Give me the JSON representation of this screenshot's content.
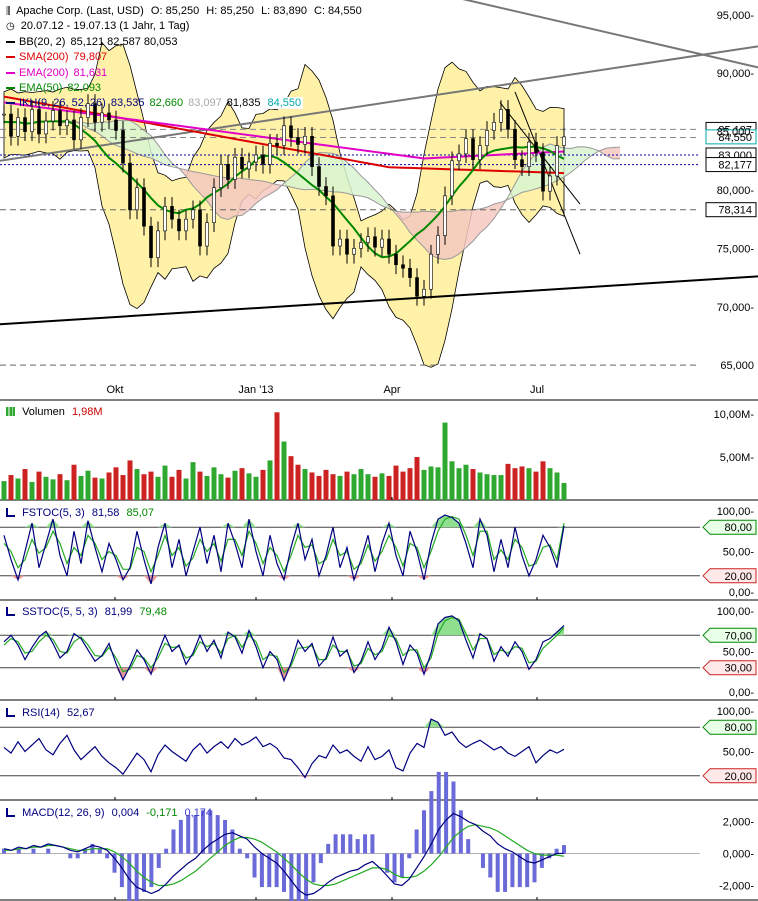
{
  "chart_data": [
    {
      "type": "line",
      "title": "Apache Corp. (Last, USD)",
      "ohlc_labels": {
        "o": "O: 85,250",
        "h": "H: 85,250",
        "l": "L: 83,890",
        "c": "C: 84,550"
      },
      "date_range": "20.07.12 - 19.07.13 (1 Jahr, 1 Tag)",
      "x_ticks": [
        "Okt",
        "Jan '13",
        "Apr",
        "Jul"
      ],
      "ylim": [
        63500,
        97000
      ],
      "y_ticks": [
        "95,000-",
        "90,000-",
        "85,000-",
        "80,000-",
        "75,000-",
        "70,000-",
        "65,000"
      ],
      "price_tags": [
        "85,187",
        "84,550",
        "83,000",
        "82,177",
        "78,314"
      ],
      "indicators": [
        {
          "name": "BB(20, 2)",
          "values": "85,121  82,587  80,053",
          "color": "#000000"
        },
        {
          "name": "SMA(200)",
          "values": "79,807",
          "color": "#dd0000"
        },
        {
          "name": "EMA(200)",
          "values": "81,631",
          "color": "#e000c8"
        },
        {
          "name": "EMA(50)",
          "values": "82,093",
          "color": "#008800"
        },
        {
          "name": "IKH(9, 26, 52, 26)",
          "values": [
            "83,535",
            "82,660",
            "83,097",
            "81,835",
            "84,550"
          ],
          "value_colors": [
            "#000080",
            "#008800",
            "#aaaaaa",
            "#000000",
            "#00aaaa"
          ],
          "color": "#000080"
        }
      ],
      "series": [
        {
          "name": "Close",
          "values": [
            86.5,
            84.6,
            86.2,
            85.0,
            86.9,
            84.8,
            85.9,
            86.8,
            85.5,
            86.0,
            84.3,
            86.2,
            87.4,
            85.8,
            86.6,
            86.0,
            85.1,
            82.3,
            78.3,
            80.2,
            76.9,
            74.2,
            76.5,
            78.6,
            77.5,
            76.5,
            77.5,
            78.3,
            75.2,
            77.2,
            80.2,
            82.2,
            80.9,
            82.8,
            81.8,
            82.4,
            83.0,
            82.2,
            84.0,
            83.8,
            85.5,
            84.5,
            83.9,
            84.6,
            82.0,
            80.3,
            79.5,
            75.2,
            75.8,
            74.5,
            75.0,
            75.5,
            76.0,
            75.1,
            75.8,
            74.5,
            73.6,
            73.3,
            72.5,
            70.9,
            71.5,
            74.5,
            76.1,
            79.5,
            82.5,
            83.1,
            84.4,
            82.6,
            83.8,
            85.1,
            85.8,
            86.9,
            85.2,
            82.6,
            82.0,
            84.1,
            83.2,
            79.9,
            81.2,
            83.8,
            84.55
          ]
        }
      ]
    },
    {
      "type": "bar",
      "title": "Volumen",
      "value_label": "1,98M",
      "y_ticks": [
        "10,00M-",
        "5,00M-"
      ],
      "values": [
        2.2,
        2.9,
        2.5,
        3.6,
        2.1,
        3.3,
        2.7,
        2.4,
        3.0,
        2.3,
        4.1,
        2.8,
        3.4,
        2.6,
        2.5,
        3.2,
        3.8,
        2.9,
        4.6,
        3.6,
        3.0,
        3.3,
        2.7,
        4.0,
        2.7,
        3.5,
        2.5,
        4.4,
        3.3,
        2.8,
        3.8,
        3.0,
        2.6,
        3.4,
        3.7,
        3.1,
        2.7,
        3.5,
        4.6,
        10.2,
        6.8,
        5.1,
        4.1,
        3.6,
        3.2,
        2.8,
        3.5,
        3.0,
        2.8,
        3.3,
        3.0,
        3.6,
        3.0,
        2.7,
        3.1,
        2.8,
        4.0,
        3.3,
        3.7,
        5.0,
        3.5,
        3.9,
        3.8,
        9.0,
        4.5,
        3.7,
        4.1,
        3.6,
        3.2,
        3.0,
        2.9,
        2.9,
        4.2,
        3.7,
        3.9,
        3.7,
        3.3,
        4.5,
        3.7,
        3.2,
        1.98
      ]
    },
    {
      "type": "line",
      "title": "FSTOC(5, 3)",
      "values_label": [
        "81,58",
        "85,07"
      ],
      "ylim": [
        0,
        100
      ],
      "y_ticks": [
        "100,00-",
        "50,00-",
        "0,00-"
      ],
      "tags": [
        "80,00",
        "20,00"
      ],
      "series": [
        {
          "name": "%K",
          "values": [
            70,
            40,
            15,
            50,
            85,
            30,
            60,
            90,
            45,
            20,
            75,
            35,
            88,
            55,
            25,
            60,
            40,
            15,
            30,
            75,
            40,
            10,
            55,
            85,
            30,
            65,
            20,
            50,
            80,
            35,
            70,
            25,
            85,
            60,
            30,
            90,
            50,
            20,
            70,
            35,
            15,
            55,
            85,
            40,
            65,
            20,
            45,
            80,
            30,
            55,
            15,
            40,
            70,
            25,
            60,
            85,
            45,
            20,
            75,
            50,
            15,
            60,
            90,
            95,
            92,
            85,
            60,
            30,
            90,
            70,
            25,
            65,
            30,
            80,
            45,
            20,
            40,
            70,
            55,
            30,
            81.58
          ]
        },
        {
          "name": "%D",
          "values": [
            60,
            50,
            30,
            40,
            65,
            48,
            55,
            75,
            60,
            35,
            55,
            45,
            70,
            60,
            40,
            50,
            45,
            28,
            28,
            55,
            50,
            25,
            45,
            70,
            45,
            55,
            32,
            42,
            65,
            50,
            60,
            38,
            65,
            65,
            45,
            75,
            60,
            35,
            55,
            45,
            25,
            45,
            70,
            55,
            58,
            35,
            40,
            65,
            45,
            50,
            28,
            35,
            58,
            38,
            50,
            70,
            55,
            32,
            60,
            55,
            30,
            50,
            75,
            90,
            93,
            90,
            70,
            45,
            75,
            75,
            40,
            52,
            40,
            65,
            55,
            32,
            35,
            55,
            58,
            40,
            85.07
          ]
        }
      ]
    },
    {
      "type": "line",
      "title": "SSTOC(5, 5, 3)",
      "values_label": [
        "81,99",
        "79,48"
      ],
      "ylim": [
        0,
        100
      ],
      "y_ticks": [
        "100,00-",
        "50,00-",
        "0,00-"
      ],
      "tags": [
        "70,00",
        "30,00"
      ],
      "series": [
        {
          "name": "%K",
          "values": [
            62,
            70,
            58,
            40,
            55,
            68,
            75,
            60,
            42,
            50,
            72,
            66,
            52,
            38,
            45,
            60,
            35,
            15,
            32,
            52,
            40,
            22,
            48,
            70,
            50,
            58,
            34,
            48,
            70,
            50,
            64,
            42,
            74,
            68,
            48,
            76,
            56,
            30,
            50,
            40,
            14,
            36,
            64,
            50,
            60,
            32,
            42,
            68,
            44,
            52,
            24,
            38,
            62,
            40,
            54,
            80,
            62,
            34,
            58,
            48,
            22,
            48,
            84,
            92,
            94,
            88,
            64,
            42,
            72,
            66,
            38,
            56,
            44,
            62,
            50,
            28,
            40,
            62,
            66,
            74,
            81.99
          ]
        },
        {
          "name": "%D",
          "values": [
            58,
            66,
            62,
            48,
            50,
            62,
            70,
            65,
            50,
            48,
            62,
            68,
            58,
            45,
            44,
            55,
            42,
            25,
            28,
            45,
            42,
            30,
            42,
            60,
            55,
            56,
            42,
            45,
            62,
            56,
            60,
            48,
            66,
            70,
            55,
            70,
            62,
            40,
            46,
            44,
            24,
            32,
            54,
            55,
            57,
            40,
            40,
            58,
            50,
            50,
            32,
            35,
            54,
            46,
            50,
            70,
            66,
            45,
            52,
            52,
            30,
            42,
            72,
            88,
            92,
            90,
            72,
            52,
            66,
            66,
            46,
            52,
            48,
            56,
            54,
            36,
            38,
            54,
            62,
            70,
            79.48
          ]
        }
      ]
    },
    {
      "type": "line",
      "title": "RSI(14)",
      "value_label": "52,67",
      "ylim": [
        0,
        100
      ],
      "y_ticks": [
        "100,00-",
        "50,00-"
      ],
      "tags": [
        "80,00",
        "20,00"
      ],
      "series": [
        {
          "name": "RSI",
          "values": [
            55,
            48,
            62,
            50,
            58,
            66,
            52,
            46,
            60,
            70,
            52,
            40,
            48,
            56,
            44,
            36,
            30,
            22,
            35,
            48,
            40,
            25,
            46,
            58,
            50,
            44,
            38,
            52,
            60,
            48,
            56,
            62,
            54,
            66,
            58,
            62,
            68,
            56,
            60,
            54,
            42,
            40,
            30,
            18,
            35,
            45,
            42,
            58,
            48,
            52,
            44,
            38,
            56,
            40,
            44,
            52,
            30,
            26,
            48,
            60,
            55,
            90,
            86,
            70,
            74,
            62,
            55,
            60,
            64,
            58,
            52,
            56,
            48,
            44,
            50,
            56,
            36,
            45,
            52,
            48,
            52.67
          ]
        }
      ]
    },
    {
      "type": "bar",
      "title": "MACD(12, 26, 9)",
      "values_label": [
        "0,004",
        "-0,171",
        "0,174"
      ],
      "y_ticks": [
        "2,000-",
        "0,000-",
        "-2,000-"
      ],
      "series": [
        {
          "name": "MACD",
          "values": [
            0.3,
            0.2,
            0.4,
            0.3,
            0.5,
            0.4,
            0.6,
            0.5,
            0.4,
            0.2,
            0.1,
            0.3,
            0.5,
            0.4,
            0.2,
            -0.3,
            -0.9,
            -1.6,
            -2.1,
            -2.3,
            -2.5,
            -2.3,
            -1.9,
            -1.4,
            -1.0,
            -0.6,
            -0.3,
            0.2,
            0.6,
            0.9,
            1.2,
            1.3,
            1.1,
            0.9,
            0.4,
            0.0,
            -0.3,
            -0.6,
            -1.1,
            -1.7,
            -2.3,
            -2.6,
            -2.5,
            -2.2,
            -1.8,
            -1.5,
            -1.3,
            -1.1,
            -1.0,
            -0.7,
            -0.5,
            -0.9,
            -1.4,
            -1.9,
            -2.0,
            -1.6,
            -0.9,
            -0.2,
            0.6,
            1.5,
            2.1,
            2.5,
            2.3,
            2.0,
            1.8,
            1.4,
            1.1,
            0.6,
            0.3,
            0.1,
            -0.2,
            -0.5,
            -0.6,
            -0.4,
            -0.2,
            0.0,
            0.004
          ]
        },
        {
          "name": "Signal",
          "values": [
            0.2,
            0.2,
            0.3,
            0.3,
            0.4,
            0.4,
            0.5,
            0.5,
            0.4,
            0.3,
            0.2,
            0.2,
            0.3,
            0.3,
            0.3,
            0.1,
            -0.2,
            -0.6,
            -1.1,
            -1.5,
            -1.8,
            -2.0,
            -2.0,
            -1.9,
            -1.7,
            -1.4,
            -1.1,
            -0.7,
            -0.3,
            0.1,
            0.5,
            0.8,
            1.0,
            1.0,
            0.9,
            0.7,
            0.4,
            0.1,
            -0.3,
            -0.7,
            -1.2,
            -1.6,
            -1.9,
            -2.0,
            -2.0,
            -1.9,
            -1.7,
            -1.5,
            -1.3,
            -1.1,
            -0.9,
            -0.9,
            -1.0,
            -1.3,
            -1.5,
            -1.5,
            -1.4,
            -1.1,
            -0.7,
            -0.2,
            0.4,
            1.0,
            1.4,
            1.7,
            1.8,
            1.7,
            1.6,
            1.4,
            1.1,
            0.8,
            0.5,
            0.2,
            0.0,
            -0.1,
            -0.1,
            -0.1,
            -0.171
          ]
        }
      ]
    }
  ],
  "colors": {
    "up": "#2fa82f",
    "down": "#cc2222",
    "bb_fill": "#fff2a8",
    "cloud_bull": "#d8f5d0",
    "cloud_bear": "#f5c8c0",
    "ob_fill": "#8fdf8f",
    "os_fill": "#e89a9a",
    "hist": "#6a6ad8"
  }
}
